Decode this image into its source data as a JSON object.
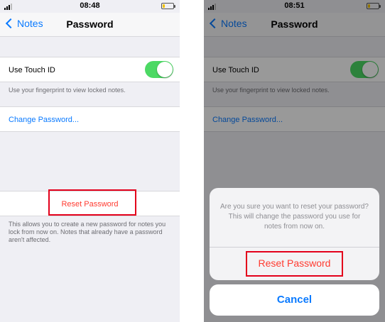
{
  "left_screen": {
    "status": {
      "time": "08:48"
    },
    "nav": {
      "back_label": "Notes",
      "title": "Password"
    },
    "touch_id": {
      "label": "Use Touch ID",
      "enabled": true,
      "footnote": "Use your fingerprint to view locked notes."
    },
    "change_password": {
      "label": "Change Password..."
    },
    "reset_password": {
      "label": "Reset Password",
      "footnote": "This allows you to create a new password for notes you lock from now on. Notes that already have a password aren't affected."
    }
  },
  "right_screen": {
    "status": {
      "time": "08:51"
    },
    "nav": {
      "back_label": "Notes",
      "title": "Password"
    },
    "touch_id": {
      "label": "Use Touch ID",
      "enabled": true,
      "footnote": "Use your fingerprint to view locked notes."
    },
    "change_password": {
      "label": "Change Password..."
    },
    "alert": {
      "message": "Are you sure you want to reset your password? This will change the password you use for notes from now on.",
      "action_label": "Reset Password",
      "cancel_label": "Cancel"
    }
  },
  "colors": {
    "ios_blue": "#0a7aff",
    "destructive_red": "#ff3b30",
    "toggle_green": "#4cd964",
    "highlight_red": "#e3001b"
  },
  "icons": [
    "signal-icon",
    "battery-icon",
    "chevron-left-icon"
  ]
}
